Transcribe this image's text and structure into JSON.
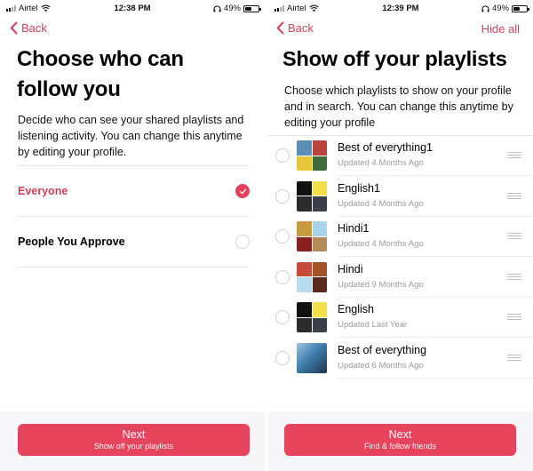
{
  "colors": {
    "accent": "#e2405d",
    "accent_text": "#d0425a",
    "button_bg": "#e6435c",
    "secondary_text": "#9a9aa0",
    "footer_bg": "#f7f7f9"
  },
  "left_screen": {
    "status_bar": {
      "carrier": "Airtel",
      "time": "12:38 PM",
      "battery": "49%",
      "battery_level": 0.49,
      "icons": [
        "signal-icon",
        "wifi-icon",
        "headphones-icon",
        "battery-icon"
      ]
    },
    "nav": {
      "back_label": "Back"
    },
    "title": "Choose who can follow you",
    "description": "Decide who can see your shared playlists and listening activity. You can change this anytime by editing your profile.",
    "options": [
      {
        "label": "Everyone",
        "selected": true
      },
      {
        "label": "People You Approve",
        "selected": false
      }
    ],
    "next_button": {
      "label": "Next",
      "sublabel": "Show off your playlists"
    }
  },
  "right_screen": {
    "status_bar": {
      "carrier": "Airtel",
      "time": "12:39 PM",
      "battery": "49%",
      "battery_level": 0.49,
      "icons": [
        "signal-icon",
        "wifi-icon",
        "headphones-icon",
        "battery-icon"
      ]
    },
    "nav": {
      "back_label": "Back",
      "action_label": "Hide all"
    },
    "title": "Show off your playlists",
    "description": "Choose which playlists to show on your profile and in search. You can change this anytime by editing your profile",
    "playlists": [
      {
        "name": "Best of everything1",
        "updated": "Updated 4 Months Ago",
        "selected": false,
        "art": [
          "#5a8fb8",
          "#b9433d",
          "#e8c53a",
          "#3f6a3a"
        ]
      },
      {
        "name": "English1",
        "updated": "Updated 4 Months Ago",
        "selected": false,
        "art": [
          "#111111",
          "#f2e04a",
          "#2b2b2b",
          "#3a3f48"
        ]
      },
      {
        "name": "Hindi1",
        "updated": "Updated 4 Months Ago",
        "selected": false,
        "art": [
          "#c99a3e",
          "#a9d3ec",
          "#8a1f1f",
          "#b28a5a"
        ]
      },
      {
        "name": "Hindi",
        "updated": "Updated 9 Months Ago",
        "selected": false,
        "art": [
          "#c84a3a",
          "#a3532a",
          "#b7dcf0",
          "#5a2a1f"
        ]
      },
      {
        "name": "English",
        "updated": "Updated Last Year",
        "selected": false,
        "art": [
          "#111111",
          "#f2e04a",
          "#2b2b2b",
          "#3a3f48"
        ]
      },
      {
        "name": "Best of everything",
        "updated": "Updated 6 Months Ago",
        "selected": false,
        "art": [
          "#3f7fae"
        ],
        "single_art": true
      }
    ],
    "next_button": {
      "label": "Next",
      "sublabel": "Find & follow friends"
    }
  }
}
